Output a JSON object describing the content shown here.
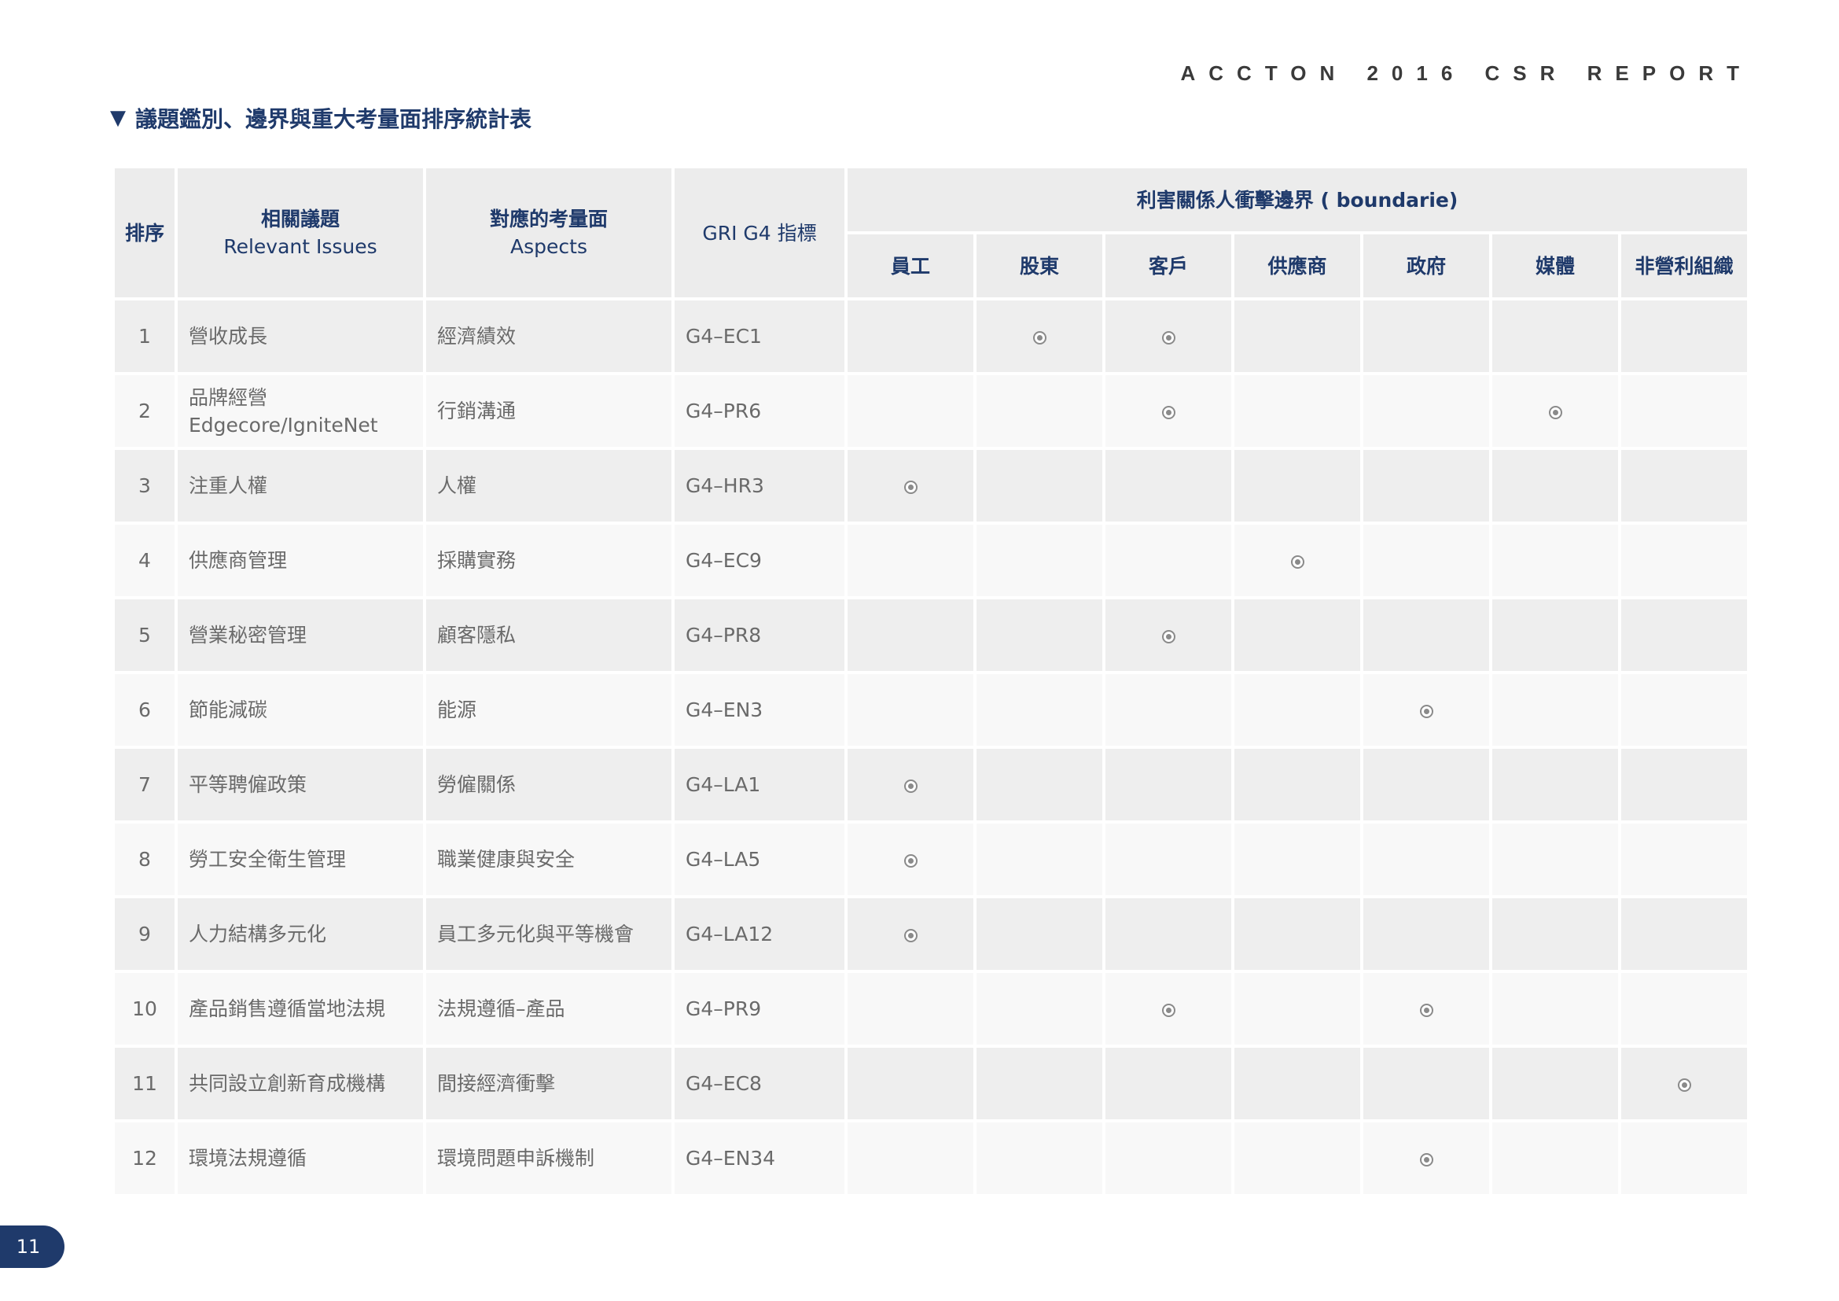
{
  "header": {
    "brand": "ACCTON 2016 CSR REPORT"
  },
  "section": {
    "title": "議題鑑別、邊界與重大考量面排序統計表"
  },
  "table": {
    "headers": {
      "rank": "排序",
      "issues_zh": "相關議題",
      "issues_en": "Relevant Issues",
      "aspects_zh": "對應的考量面",
      "aspects_en": "Aspects",
      "gri": "GRI G4 指標",
      "boundary": "利害關係人衝擊邊界 ( boundarie)",
      "stakeholders": [
        "員工",
        "股東",
        "客戶",
        "供應商",
        "政府",
        "媒體",
        "非營利組織"
      ]
    },
    "rows": [
      {
        "rank": "1",
        "issue": "營收成長",
        "aspect": "經濟績效",
        "gri": "G4–EC1",
        "marks": [
          false,
          true,
          true,
          false,
          false,
          false,
          false
        ]
      },
      {
        "rank": "2",
        "issue": "品牌經營 Edgecore/IgniteNet",
        "aspect": "行銷溝通",
        "gri": "G4–PR6",
        "marks": [
          false,
          false,
          true,
          false,
          false,
          true,
          false
        ]
      },
      {
        "rank": "3",
        "issue": "注重人權",
        "aspect": "人權",
        "gri": "G4–HR3",
        "marks": [
          true,
          false,
          false,
          false,
          false,
          false,
          false
        ]
      },
      {
        "rank": "4",
        "issue": "供應商管理",
        "aspect": "採購實務",
        "gri": "G4–EC9",
        "marks": [
          false,
          false,
          false,
          true,
          false,
          false,
          false
        ]
      },
      {
        "rank": "5",
        "issue": "營業秘密管理",
        "aspect": "顧客隱私",
        "gri": "G4–PR8",
        "marks": [
          false,
          false,
          true,
          false,
          false,
          false,
          false
        ]
      },
      {
        "rank": "6",
        "issue": "節能減碳",
        "aspect": "能源",
        "gri": "G4–EN3",
        "marks": [
          false,
          false,
          false,
          false,
          true,
          false,
          false
        ]
      },
      {
        "rank": "7",
        "issue": "平等聘僱政策",
        "aspect": "勞僱關係",
        "gri": "G4–LA1",
        "marks": [
          true,
          false,
          false,
          false,
          false,
          false,
          false
        ]
      },
      {
        "rank": "8",
        "issue": "勞工安全衛生管理",
        "aspect": "職業健康與安全",
        "gri": "G4–LA5",
        "marks": [
          true,
          false,
          false,
          false,
          false,
          false,
          false
        ]
      },
      {
        "rank": "9",
        "issue": "人力結構多元化",
        "aspect": "員工多元化與平等機會",
        "gri": "G4–LA12",
        "marks": [
          true,
          false,
          false,
          false,
          false,
          false,
          false
        ]
      },
      {
        "rank": "10",
        "issue": "產品銷售遵循當地法規",
        "aspect": "法規遵循–產品",
        "gri": "G4–PR9",
        "marks": [
          false,
          false,
          true,
          false,
          true,
          false,
          false
        ]
      },
      {
        "rank": "11",
        "issue": "共同設立創新育成機構",
        "aspect": "間接經濟衝擊",
        "gri": "G4–EC8",
        "marks": [
          false,
          false,
          false,
          false,
          false,
          false,
          true
        ]
      },
      {
        "rank": "12",
        "issue": "環境法規遵循",
        "aspect": "環境問題申訴機制",
        "gri": "G4–EN34",
        "marks": [
          false,
          false,
          false,
          false,
          true,
          false,
          false
        ]
      }
    ]
  },
  "footer": {
    "page_number": "11"
  },
  "colors": {
    "accent": "#1f3a6b",
    "header_bg": "#ececec",
    "row_odd": "#eeeeee",
    "row_even": "#f8f8f8"
  }
}
